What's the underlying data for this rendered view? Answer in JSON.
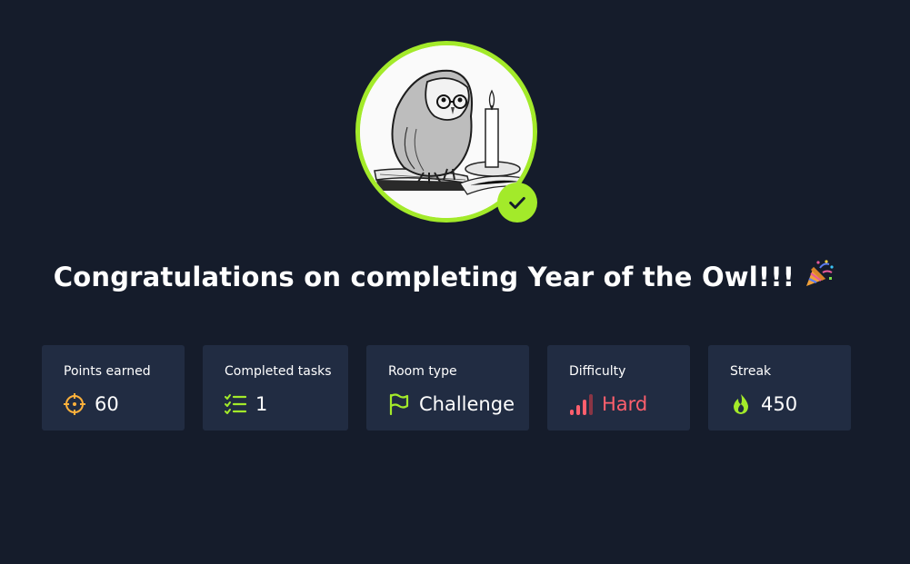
{
  "page": {
    "title": "Congratulations on completing Year of the Owl!!!",
    "title_icon": "party-popper-icon",
    "avatar_icon": "owl-illustration",
    "badge_icon": "checkmark-icon"
  },
  "stats": [
    {
      "label": "Points earned",
      "value": "60",
      "icon": "crosshair-icon"
    },
    {
      "label": "Completed tasks",
      "value": "1",
      "icon": "tasks-list-icon"
    },
    {
      "label": "Room type",
      "value": "Challenge",
      "icon": "flag-icon"
    },
    {
      "label": "Difficulty",
      "value": "Hard",
      "icon": "signal-bars-icon"
    },
    {
      "label": "Streak",
      "value": "450",
      "icon": "flame-icon"
    }
  ],
  "colors": {
    "background": "#151c2b",
    "card": "#212c42",
    "accent_green": "#a3ea2a",
    "points_orange": "#ffb13b",
    "hard_red": "#ff5f6d"
  }
}
